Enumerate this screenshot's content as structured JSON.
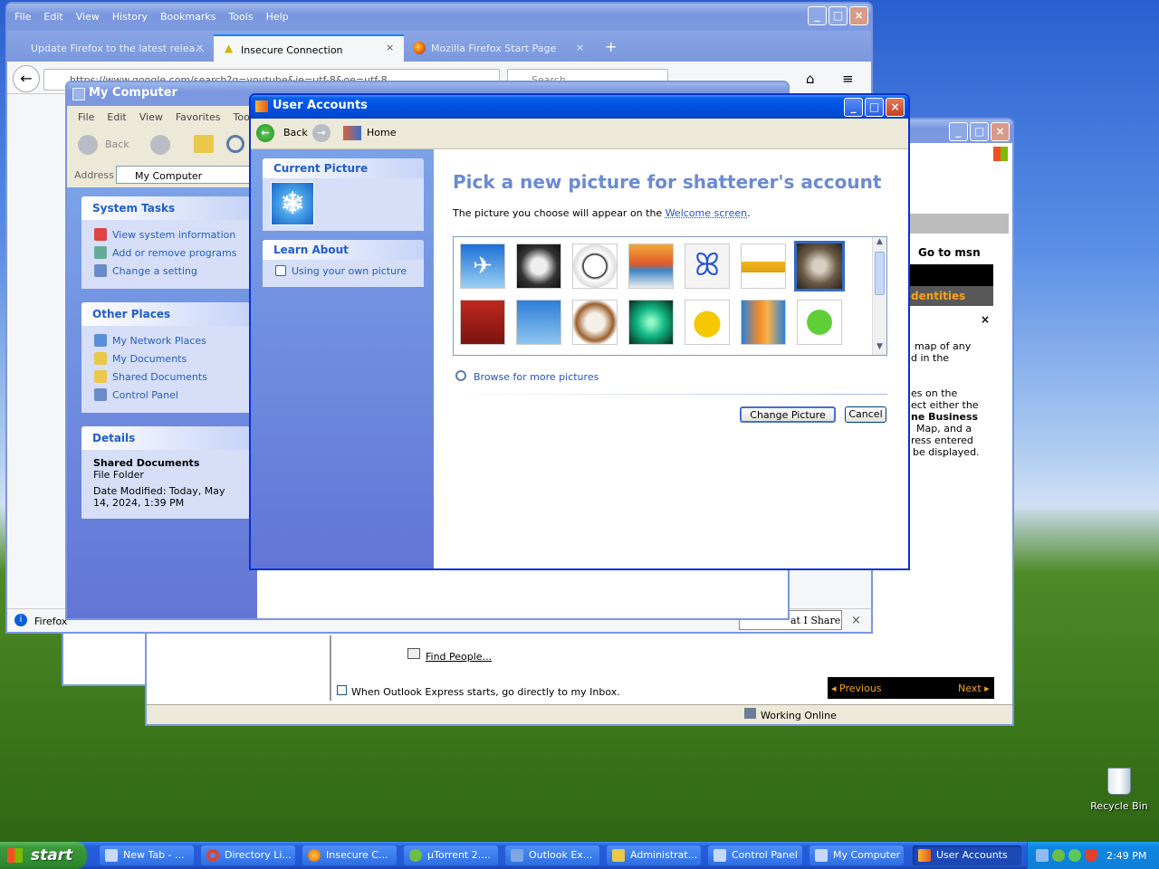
{
  "firefox": {
    "menu": [
      "File",
      "Edit",
      "View",
      "History",
      "Bookmarks",
      "Tools",
      "Help"
    ],
    "tabs": [
      "Update Firefox to the latest relea...",
      "Insecure Connection",
      "Mozilla Firefox Start Page"
    ],
    "url": "https://www.google.com/search?q=youtube&ie=utf-8&oe=utf-8",
    "search_placeholder": "Search",
    "status": "Firefox"
  },
  "mycomputer": {
    "title": "My Computer",
    "menu": [
      "File",
      "Edit",
      "View",
      "Favorites",
      "Tools"
    ],
    "back": "Back",
    "address_label": "Address",
    "address_value": "My Computer",
    "system_tasks": {
      "title": "System Tasks",
      "items": [
        "View system information",
        "Add or remove programs",
        "Change a setting"
      ]
    },
    "other_places": {
      "title": "Other Places",
      "items": [
        "My Network Places",
        "My Documents",
        "Shared Documents",
        "Control Panel"
      ]
    },
    "details": {
      "title": "Details",
      "name": "Shared Documents",
      "type": "File Folder",
      "modified": "Date Modified: Today, May 14, 2024, 1:39 PM"
    }
  },
  "useraccounts": {
    "title": "User Accounts",
    "back": "Back",
    "home": "Home",
    "current_picture": "Current Picture",
    "learn_about": "Learn About",
    "learn_item": "Using your own picture",
    "heading": "Pick a new picture for shatterer's account",
    "desc_prefix": "The picture you choose will appear on the ",
    "desc_link": "Welcome screen",
    "desc_suffix": ".",
    "browse": "Browse for more pictures",
    "change_btn": "Change Picture",
    "cancel_btn": "Cancel"
  },
  "msn": {
    "goto": "Go to msn",
    "identities": "dentities",
    "text1": "map of any",
    "text2": "d in the",
    "text3": "es on the",
    "text4": "ect either the",
    "text5": "ne Business",
    "text6": "Map, and a",
    "text7": "ress entered",
    "text8": "be displayed.",
    "share": "at I Share",
    "previous": "Previous",
    "next": "Next"
  },
  "outlook": {
    "find_people": "Find People...",
    "startup": "When Outlook Express starts, go directly to my Inbox.",
    "status": "Working Online"
  },
  "desktop": {
    "recycle_bin": "Recycle Bin"
  },
  "taskbar": {
    "start": "start",
    "items": [
      "New Tab - ...",
      "Directory Li...",
      "Insecure C...",
      "µTorrent 2....",
      "Outlook Ex...",
      "Administrat...",
      "Control Panel",
      "My Computer",
      "User Accounts"
    ],
    "time": "2:49 PM"
  }
}
